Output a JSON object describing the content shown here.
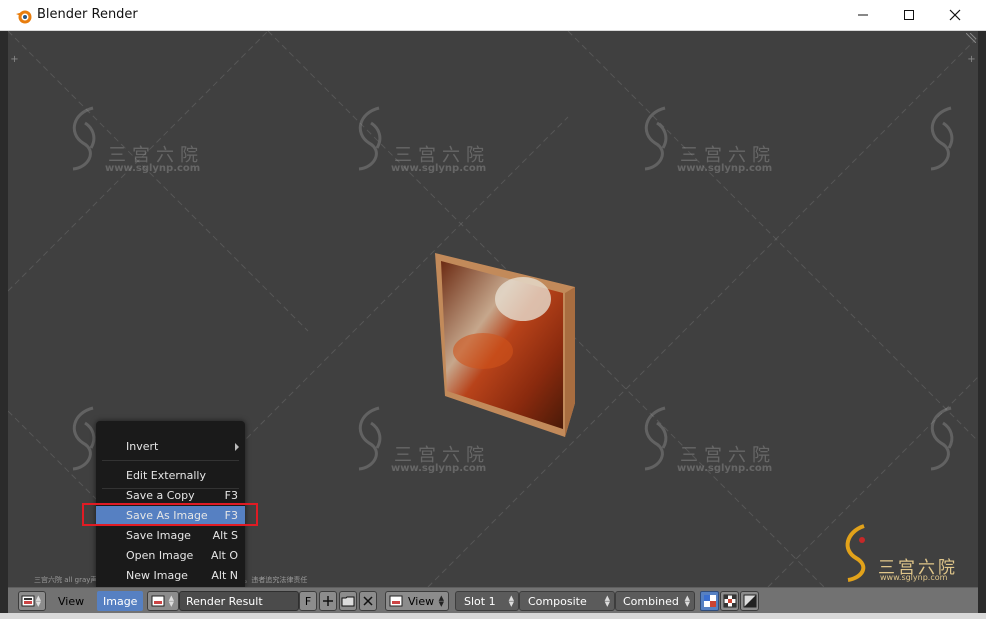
{
  "window": {
    "title": "Blender Render",
    "controls": [
      "minimize-icon",
      "maximize-icon",
      "close-icon"
    ]
  },
  "viewport": {
    "watermark_text": "三宫六院",
    "watermark_url": "www.sglynp.com",
    "footer_note": "三宫六院 all gray声明：未经授权，禁止任何组织或个人分发、售卖。违者追究法律责任",
    "logo_text": "三宫六院",
    "logo_url": "www.sglynp.com"
  },
  "image_menu": {
    "items": [
      {
        "label": "Invert",
        "shortcut": "",
        "submenu": true,
        "selected": false
      },
      {
        "label": "Edit Externally",
        "shortcut": "",
        "submenu": false,
        "selected": false
      },
      {
        "label": "Save a Copy",
        "shortcut": "F3",
        "submenu": false,
        "selected": false
      },
      {
        "label": "Save As Image",
        "shortcut": "F3",
        "submenu": false,
        "selected": true
      },
      {
        "label": "Save Image",
        "shortcut": "Alt S",
        "submenu": false,
        "selected": false
      },
      {
        "label": "Open Image",
        "shortcut": "Alt O",
        "submenu": false,
        "selected": false
      },
      {
        "label": "New Image",
        "shortcut": "Alt N",
        "submenu": false,
        "selected": false
      }
    ]
  },
  "header": {
    "editor_type_icon": "image-editor-icon",
    "menus": {
      "view": "View",
      "image": "Image"
    },
    "image_browse_icon": "image-browse-icon",
    "image_name": "Render Result",
    "fake_user": "F",
    "new_icon": "plus-icon",
    "open_icon": "folder-icon",
    "unlink_icon": "x-icon",
    "display_icon": "view-icon",
    "view_label": "View",
    "slot": "Slot 1",
    "pass_layer": "Composite",
    "render_pass": "Combined",
    "toggle_icons": [
      "draw-alpha-icon",
      "checker-icon",
      "diagonal-icon"
    ]
  },
  "colors": {
    "accent": "#5680c2",
    "highlight_box": "#e01b24",
    "viewport_bg": "#404040",
    "header_bg": "#727272"
  }
}
